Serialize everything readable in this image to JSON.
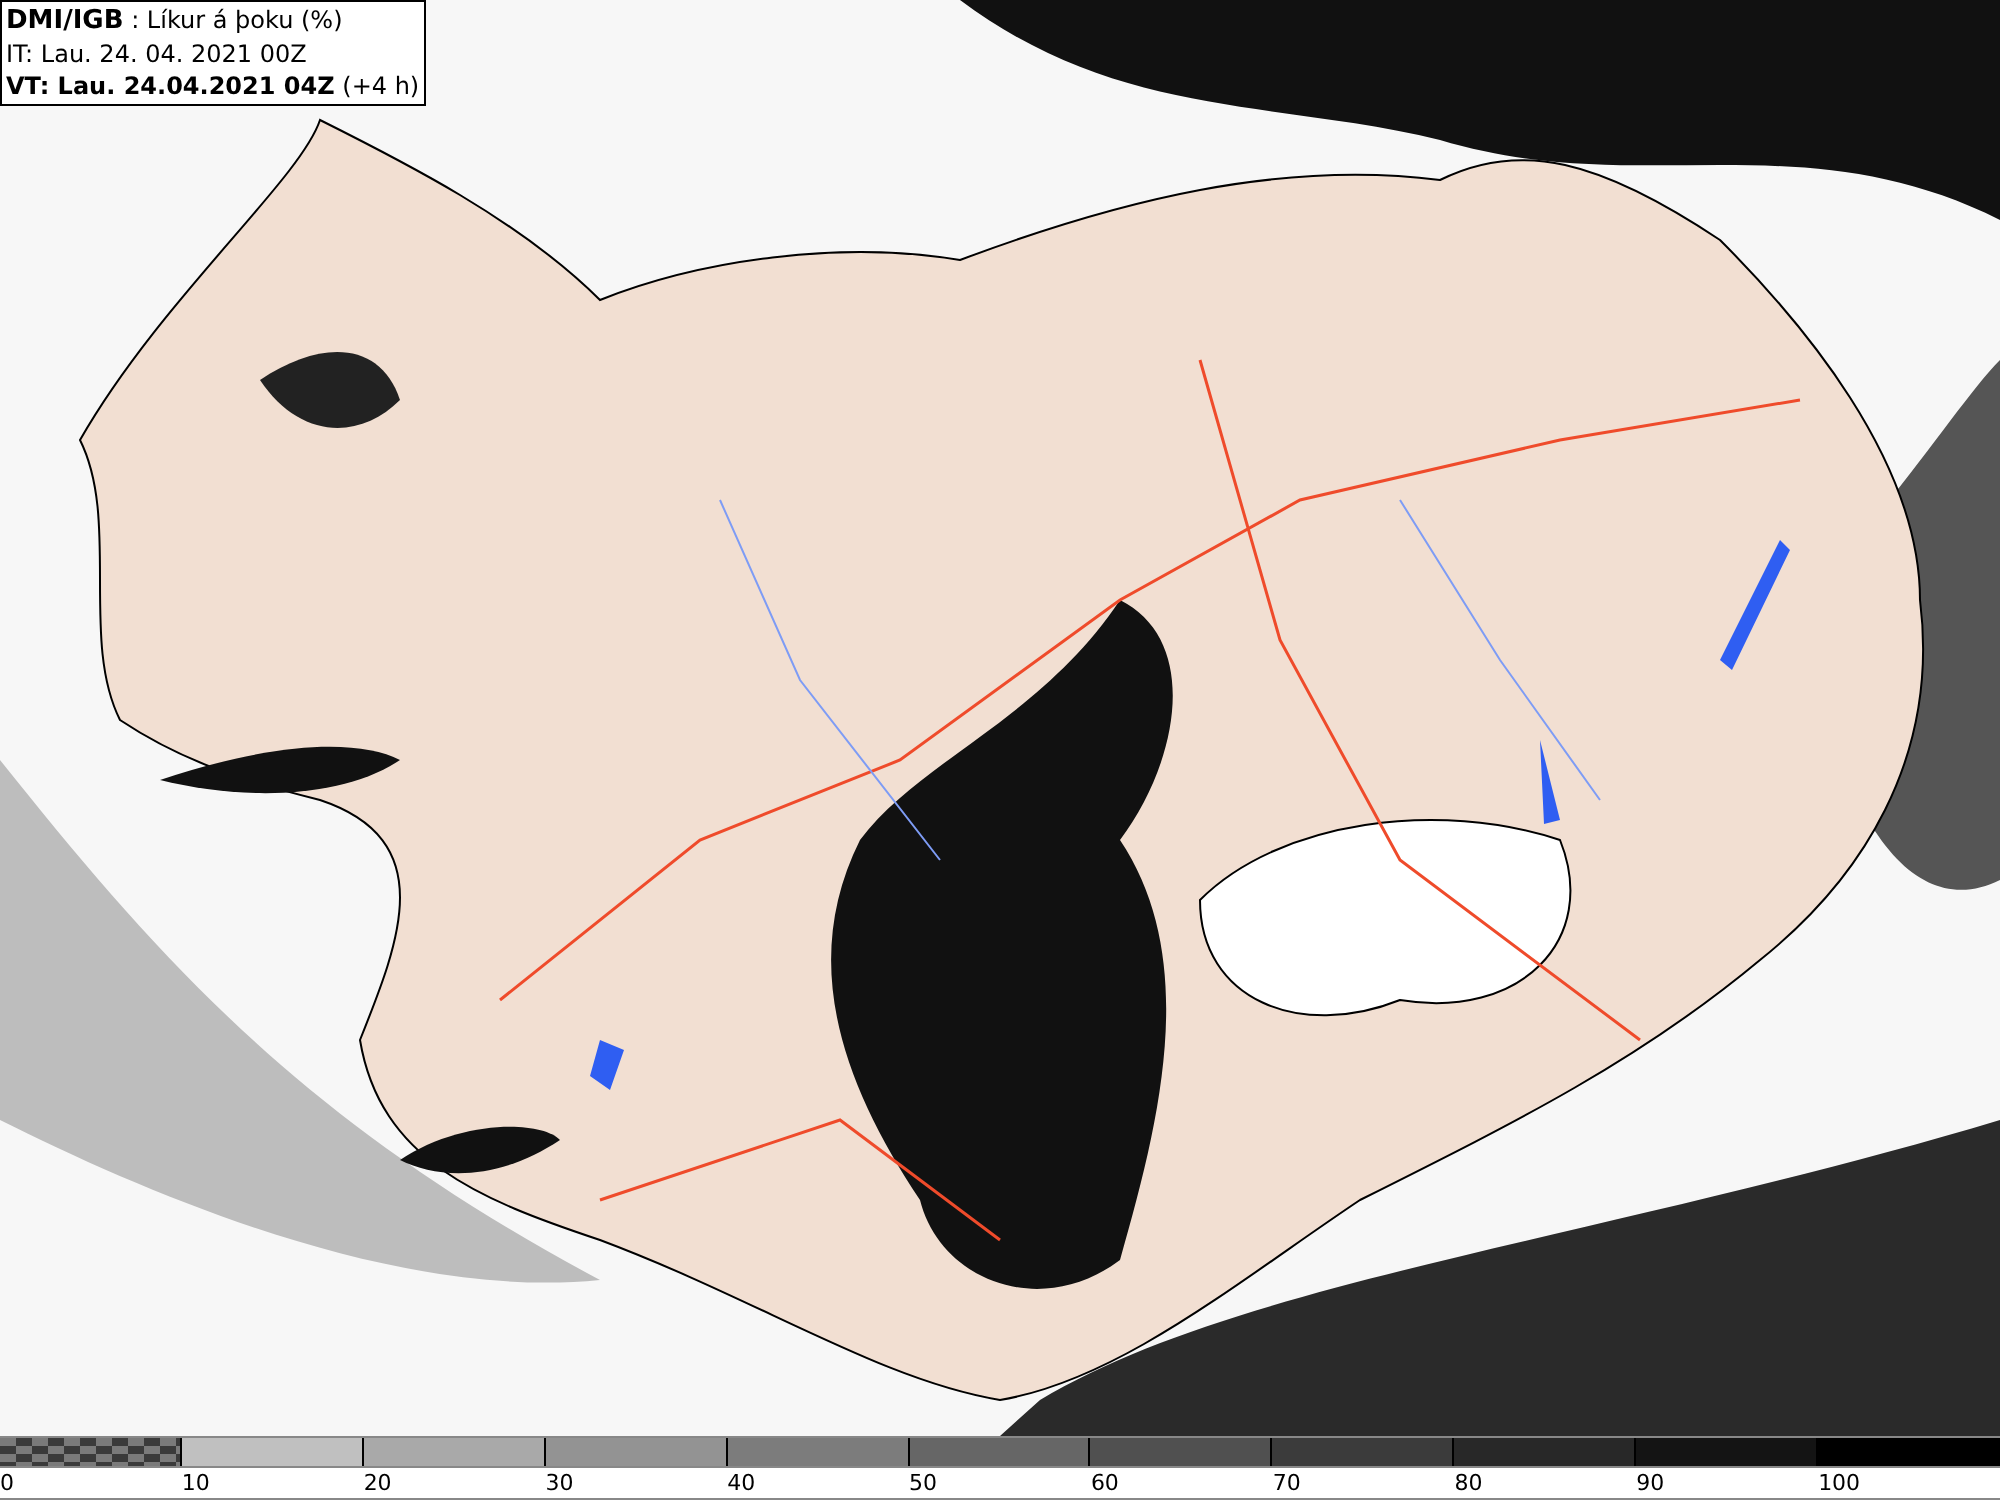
{
  "header": {
    "source": "DMI/IGB",
    "title": ": Líkur á þoku (%)",
    "issue_time": "IT: Lau. 24. 04. 2021 00Z",
    "valid_time": "VT: Lau. 24.04.2021 04Z",
    "lead": "(+4 h)"
  },
  "legend": [
    {
      "label": "0",
      "kind": "checker",
      "color": "#7a7a7a"
    },
    {
      "label": "10",
      "kind": "solid",
      "color": "#c0c0c0"
    },
    {
      "label": "20",
      "kind": "solid",
      "color": "#a9a9a9"
    },
    {
      "label": "30",
      "kind": "solid",
      "color": "#939393"
    },
    {
      "label": "40",
      "kind": "solid",
      "color": "#7c7c7c"
    },
    {
      "label": "50",
      "kind": "solid",
      "color": "#666666"
    },
    {
      "label": "60",
      "kind": "solid",
      "color": "#505050"
    },
    {
      "label": "70",
      "kind": "solid",
      "color": "#3b3b3b"
    },
    {
      "label": "80",
      "kind": "solid",
      "color": "#282828"
    },
    {
      "label": "90",
      "kind": "solid",
      "color": "#141414"
    },
    {
      "label": "100",
      "kind": "solid",
      "color": "#000000"
    }
  ]
}
